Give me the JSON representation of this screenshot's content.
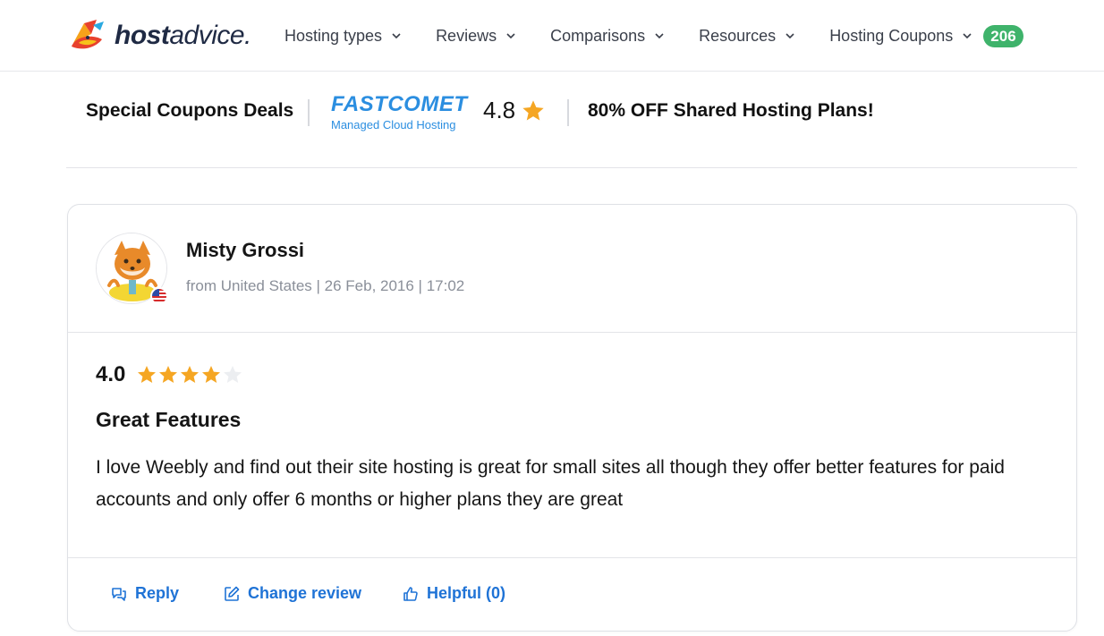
{
  "brand": {
    "name_bold": "host",
    "name_light": "advice."
  },
  "nav": {
    "items": [
      {
        "label": "Hosting types"
      },
      {
        "label": "Reviews"
      },
      {
        "label": "Comparisons"
      },
      {
        "label": "Resources"
      },
      {
        "label": "Hosting Coupons"
      }
    ],
    "coupons_badge": "206"
  },
  "promo": {
    "title": "Special Coupons Deals",
    "provider_name": "FASTCOMET",
    "provider_tagline": "Managed Cloud Hosting",
    "rating": "4.8",
    "offer": "80% OFF Shared Hosting Plans!"
  },
  "review": {
    "reviewer_name": "Misty Grossi",
    "meta": "from United States | 26 Feb, 2016 | 17:02",
    "rating": "4.0",
    "stars_filled": 4,
    "stars_total": 5,
    "title": "Great Features",
    "body": "I love Weebly and find out their site hosting is great for small sites all though they offer better features for paid accounts and only offer 6 months or higher plans they are great"
  },
  "actions": {
    "reply": "Reply",
    "change_review": "Change review",
    "helpful": "Helpful (0)"
  },
  "colors": {
    "accent_blue": "#1f73d6",
    "star": "#f5a623",
    "badge_green": "#3fb36b",
    "fastcomet_blue": "#2b8ee0"
  }
}
